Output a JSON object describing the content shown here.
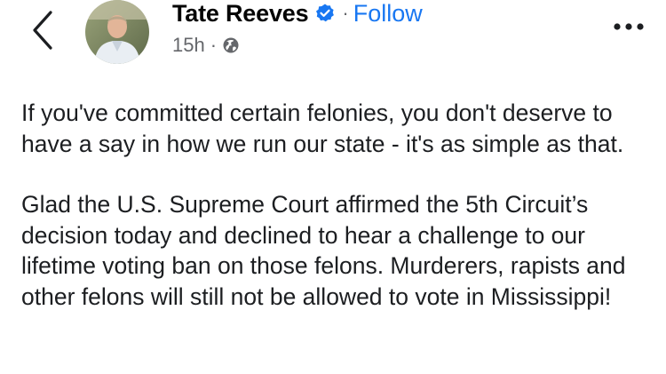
{
  "post": {
    "author": "Tate Reeves",
    "follow_label": "Follow",
    "separator": "·",
    "timestamp": "15h",
    "meta_separator": "·",
    "audience_icon": "globe-icon",
    "paragraphs": [
      "If you've committed certain felonies, you don't deserve to have a say in how we run our state - it's as simple as that.",
      "Glad the U.S. Supreme Court affirmed the 5th Circuit’s decision today and declined to hear a challenge to our lifetime voting ban on those felons.  Murderers, rapists and other felons will still not be allowed to vote in Mississippi!"
    ]
  },
  "icons": {
    "back": "chevron-left-icon",
    "verified": "verified-badge-icon",
    "more": "more-options-icon"
  },
  "colors": {
    "link": "#1877f2",
    "verified": "#1877f2",
    "secondary_text": "#65676b"
  }
}
